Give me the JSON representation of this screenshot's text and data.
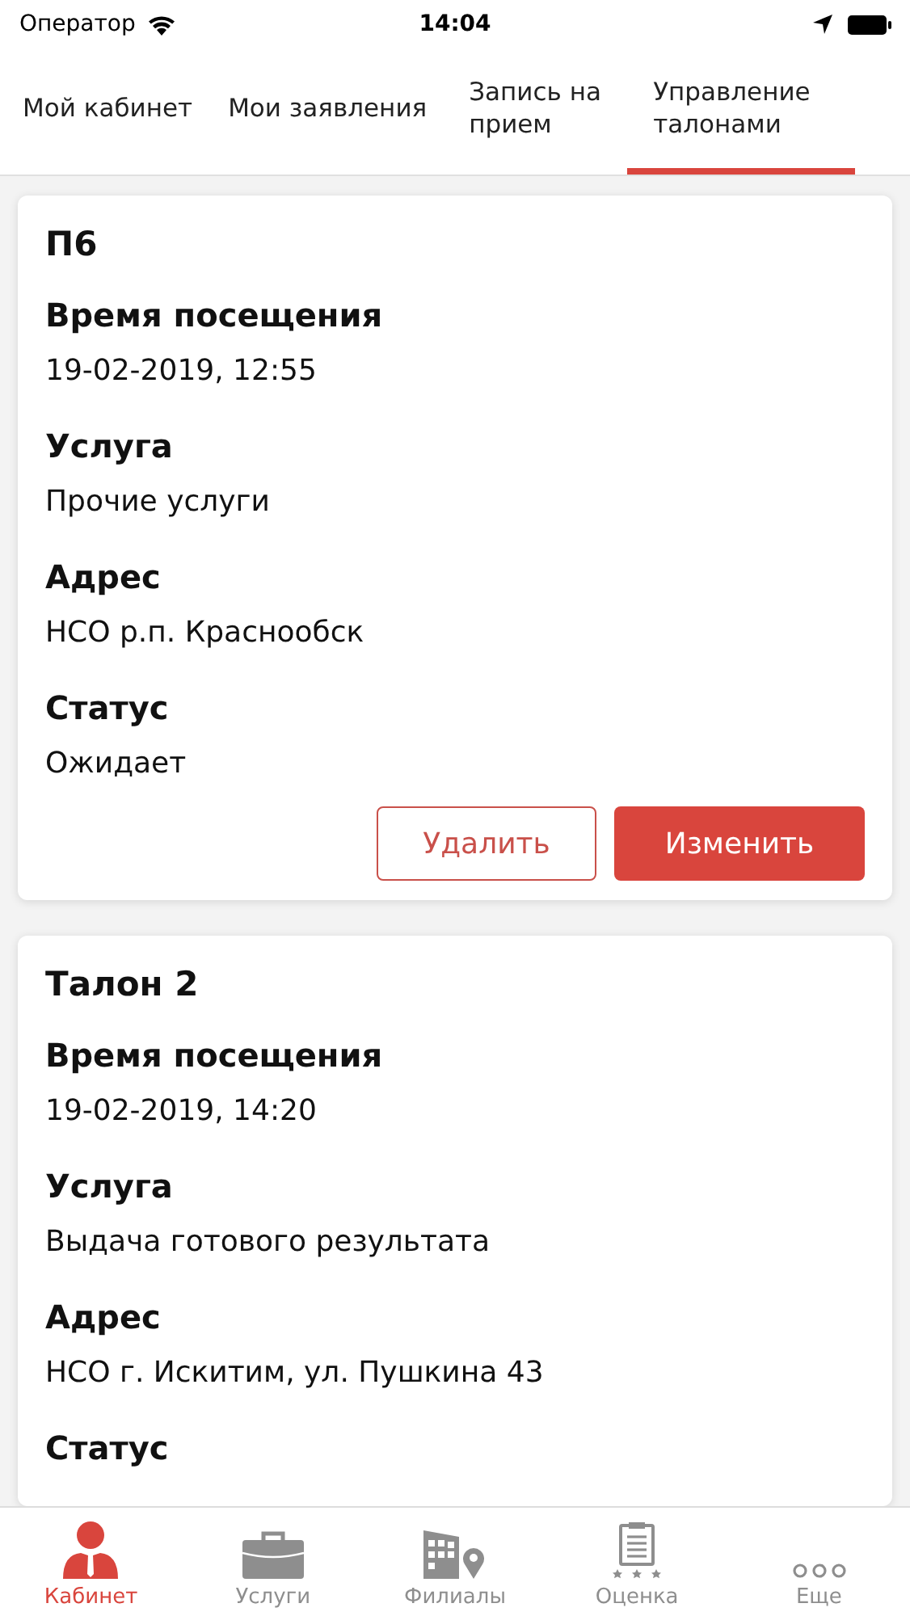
{
  "status_bar": {
    "carrier": "Оператор",
    "time": "14:04"
  },
  "tabs": [
    {
      "label": "Мой кабинет",
      "selected": false
    },
    {
      "label": "Мои заявления",
      "selected": false
    },
    {
      "label": "Запись на прием",
      "selected": false
    },
    {
      "label": "Управление талонами",
      "selected": true
    }
  ],
  "tickets": [
    {
      "title": "П6",
      "fields": [
        {
          "label": "Время посещения",
          "value": "19-02-2019, 12:55"
        },
        {
          "label": "Услуга",
          "value": "Прочие услуги"
        },
        {
          "label": "Адрес",
          "value": "НСО р.п. Краснообск"
        },
        {
          "label": "Статус",
          "value": "Ожидает"
        }
      ],
      "buttons": [
        {
          "label": "Удалить",
          "kind": "outline"
        },
        {
          "label": "Изменить",
          "kind": "filled"
        }
      ]
    },
    {
      "title": "Талон 2",
      "fields": [
        {
          "label": "Время посещения",
          "value": "19-02-2019, 14:20"
        },
        {
          "label": "Услуга",
          "value": "Выдача готового результата"
        },
        {
          "label": "Адрес",
          "value": "НСО г. Искитим, ул. Пушкина 43"
        },
        {
          "label": "Статус"
        }
      ]
    }
  ],
  "bottom_tabs": [
    {
      "label": "Кабинет",
      "selected": true
    },
    {
      "label": "Услуги",
      "selected": false
    },
    {
      "label": "Филиалы",
      "selected": false
    },
    {
      "label": "Оценка",
      "selected": false
    },
    {
      "label": "Еще",
      "selected": false
    }
  ]
}
